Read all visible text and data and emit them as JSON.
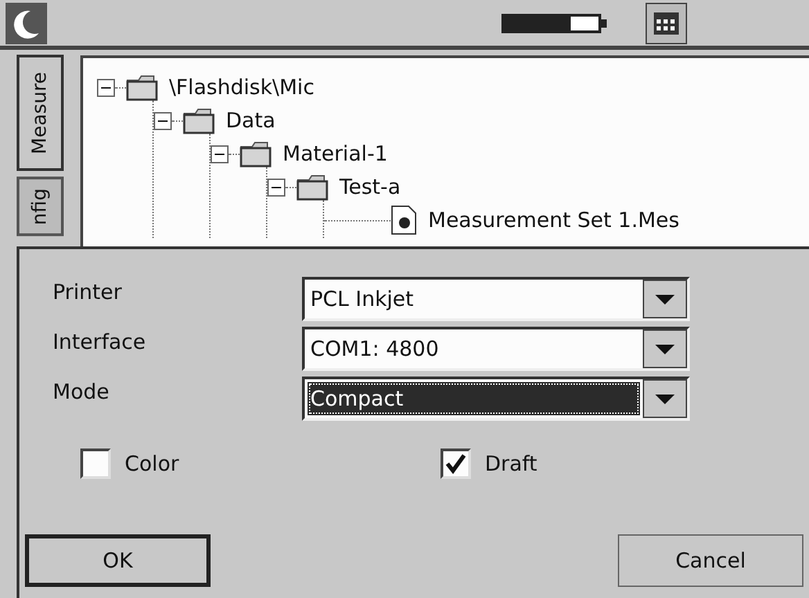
{
  "sidebar_tabs": [
    {
      "label": "Measure",
      "selected": true
    },
    {
      "label": "nfig",
      "selected": false
    }
  ],
  "tree": [
    {
      "label": "\\Flashdisk\\Mic",
      "kind": "folder",
      "expanded": true,
      "children": [
        {
          "label": "Data",
          "kind": "folder",
          "expanded": true,
          "children": [
            {
              "label": "Material-1",
              "kind": "folder",
              "expanded": true,
              "children": [
                {
                  "label": "Test-a",
                  "kind": "folder",
                  "expanded": true,
                  "children": [
                    {
                      "label": "Measurement Set 1.Mes",
                      "kind": "file"
                    }
                  ]
                }
              ]
            }
          ]
        }
      ]
    }
  ],
  "dialog": {
    "fields": [
      {
        "label": "Printer",
        "value": "PCL Inkjet",
        "focused": false
      },
      {
        "label": "Interface",
        "value": "COM1: 4800",
        "focused": false
      },
      {
        "label": "Mode",
        "value": "Compact",
        "focused": true
      }
    ],
    "checkboxes": [
      {
        "label": "Color",
        "checked": false
      },
      {
        "label": "Draft",
        "checked": true
      }
    ],
    "buttons": [
      {
        "label": "OK",
        "default": true
      },
      {
        "label": "Cancel",
        "default": false
      }
    ]
  }
}
